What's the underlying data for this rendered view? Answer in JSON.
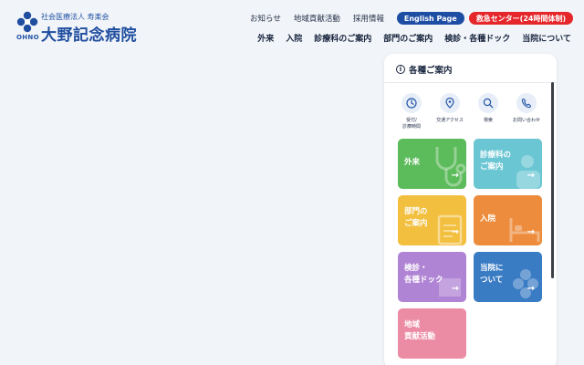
{
  "logo": {
    "corp": "社会医療法人 寿楽会",
    "name": "大野記念病院",
    "en": "OHNO"
  },
  "util_nav": {
    "news": "お知らせ",
    "community": "地域貢献活動",
    "recruit": "採用情報",
    "english": "English Page",
    "emergency": "救急センター(24時間体制)"
  },
  "main_nav": [
    "外来",
    "入院",
    "診療科のご案内",
    "部門のご案内",
    "検診・各種ドック",
    "当院について"
  ],
  "panel": {
    "title": "各種ご案内",
    "quick_links": [
      {
        "label": "受付/\n診療時間",
        "icon": "clock-icon"
      },
      {
        "label": "交通アクセス",
        "icon": "map-pin-icon"
      },
      {
        "label": "検索",
        "icon": "search-icon"
      },
      {
        "label": "お問い合わせ",
        "icon": "phone-icon"
      }
    ],
    "tiles": [
      {
        "label": "外来",
        "color": "#5cbb5b"
      },
      {
        "label": "診療科の\nご案内",
        "color": "#6bc6d3"
      },
      {
        "label": "部門の\nご案内",
        "color": "#f2bf3f"
      },
      {
        "label": "入院",
        "color": "#ec8c3c"
      },
      {
        "label": "検診・\n各種ドック",
        "color": "#b084d4"
      },
      {
        "label": "当院に\nついて",
        "color": "#3a7cc4"
      },
      {
        "label": "地域\n貢献活動",
        "color": "#ec8ca4"
      }
    ],
    "arrow": "→"
  },
  "colors": {
    "brand": "#1f4ea0",
    "emergency": "#e5262a",
    "bg": "#f1f4f8"
  }
}
